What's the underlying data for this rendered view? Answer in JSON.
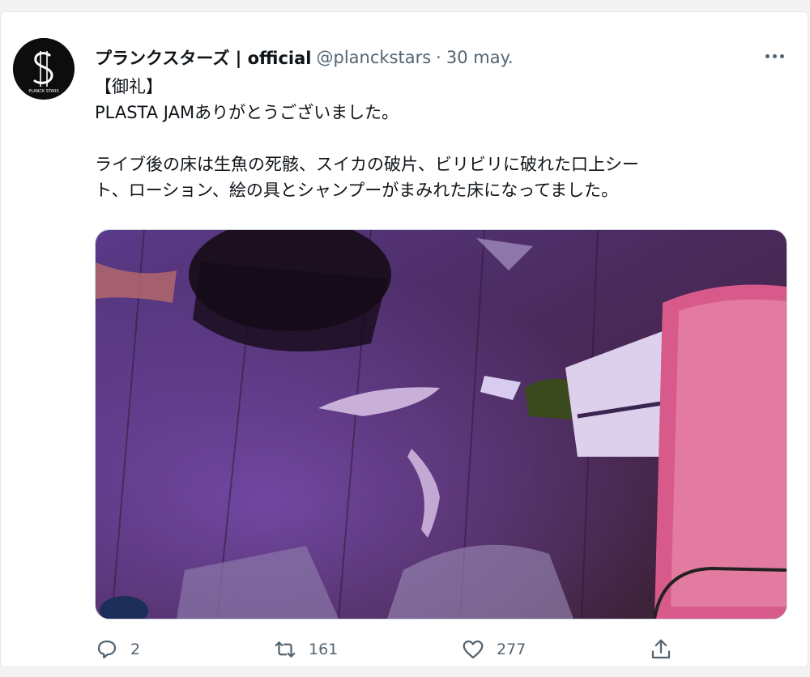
{
  "tweet": {
    "display_name": "プランクスターズ | official",
    "handle": "@planckstars",
    "separator": "·",
    "date": "30 may.",
    "avatar_text": "PLANCK STARS",
    "lines": [
      "【御礼】",
      "PLASTA JAMありがとうございました。",
      "ライブ後の床は生魚の死骸、スイカの破片、ビリビリに破れた口上シー",
      "ト、ローション、絵の具とシャンプーがまみれた床になってました。"
    ],
    "media_description": "photo",
    "actions": {
      "reply_count": "2",
      "retweet_count": "161",
      "like_count": "277"
    },
    "icons": {
      "more": "more-horizontal-icon",
      "reply": "reply-icon",
      "retweet": "retweet-icon",
      "like": "heart-icon",
      "share": "share-icon"
    },
    "colors": {
      "text": "#0f1419",
      "secondary": "#536471"
    }
  }
}
